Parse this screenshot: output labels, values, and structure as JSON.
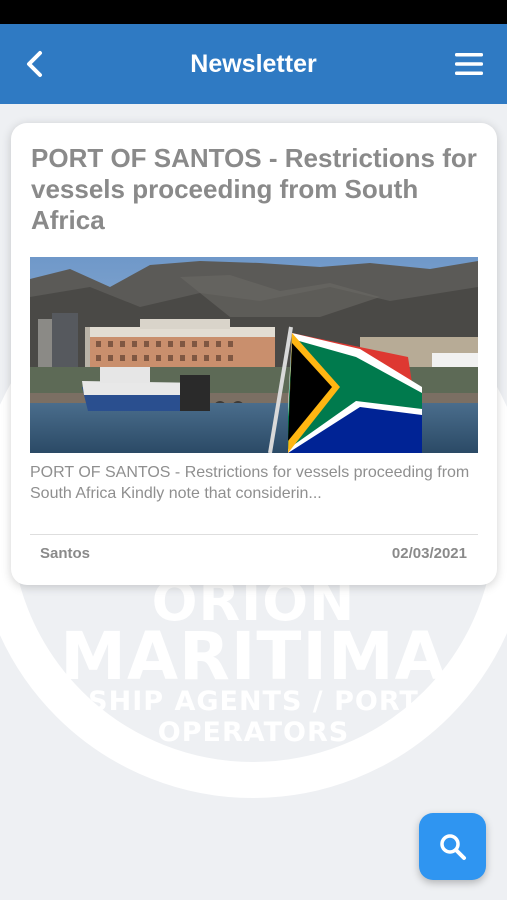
{
  "header": {
    "title": "Newsletter"
  },
  "watermark": {
    "line1": "ORION",
    "line2": "MARITIMA",
    "line3": "SHIP AGENTS / PORT OPERATORS"
  },
  "news": [
    {
      "title": "PORT OF SANTOS - Restrictions for vessels proceeding from South Africa",
      "excerpt": "PORT OF SANTOS - Restrictions for vessels proceeding from South Africa   Kindly note that considerin...",
      "location": "Santos",
      "date": "02/03/2021"
    }
  ],
  "icons": {
    "back": "chevron-left-icon",
    "menu": "hamburger-menu-icon",
    "search": "search-icon"
  },
  "colors": {
    "header_bg": "#2f7ac3",
    "fab_bg": "#2f95f1",
    "background": "#eef0f3"
  }
}
